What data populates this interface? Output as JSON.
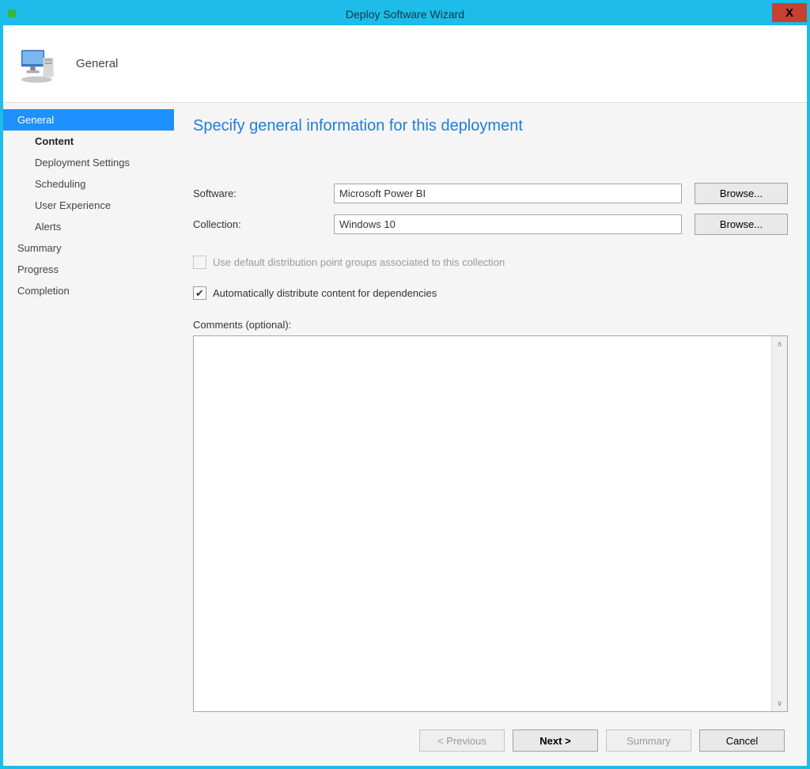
{
  "window": {
    "title": "Deploy Software Wizard",
    "close_glyph": "X"
  },
  "header": {
    "heading": "General"
  },
  "sidebar": {
    "items": [
      {
        "label": "General",
        "level": "top",
        "selected": true,
        "bold": false
      },
      {
        "label": "Content",
        "level": "child",
        "selected": false,
        "bold": true
      },
      {
        "label": "Deployment Settings",
        "level": "child",
        "selected": false,
        "bold": false
      },
      {
        "label": "Scheduling",
        "level": "child",
        "selected": false,
        "bold": false
      },
      {
        "label": "User Experience",
        "level": "child",
        "selected": false,
        "bold": false
      },
      {
        "label": "Alerts",
        "level": "child",
        "selected": false,
        "bold": false
      },
      {
        "label": "Summary",
        "level": "top",
        "selected": false,
        "bold": false
      },
      {
        "label": "Progress",
        "level": "top",
        "selected": false,
        "bold": false
      },
      {
        "label": "Completion",
        "level": "top",
        "selected": false,
        "bold": false
      }
    ]
  },
  "main": {
    "title": "Specify general information for this deployment",
    "software_label": "Software:",
    "software_value": "Microsoft Power BI",
    "collection_label": "Collection:",
    "collection_value": "Windows 10",
    "browse_label": "Browse...",
    "chk_default_dist_label": "Use default distribution point groups associated to this collection",
    "chk_default_dist_checked": false,
    "chk_default_dist_enabled": false,
    "chk_auto_dist_label": "Automatically distribute content for dependencies",
    "chk_auto_dist_checked": true,
    "comments_label": "Comments (optional):",
    "comments_value": ""
  },
  "footer": {
    "previous": "< Previous",
    "next": "Next >",
    "summary": "Summary",
    "cancel": "Cancel"
  }
}
